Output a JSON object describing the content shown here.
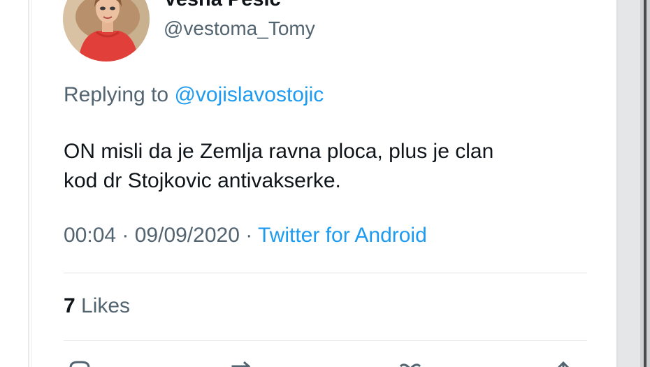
{
  "tweet": {
    "author": {
      "display_name": "Vesna Pesic",
      "handle": "@vestoma_Tomy"
    },
    "reply": {
      "prefix": "Replying to ",
      "mention": "@vojislavostojic"
    },
    "text_line1": "ON misli da je Zemlja ravna ploca, plus je clan",
    "text_line2": "kod dr Stojkovic antivakserke.",
    "timestamp": "00:04 · 09/09/2020 · ",
    "source": "Twitter for Android",
    "likes": {
      "count": "7",
      "label": " Likes"
    }
  },
  "icons": {
    "more": "chevron-down-icon",
    "actions": [
      "reply-icon",
      "retweet-icon",
      "like-icon",
      "share-icon"
    ]
  },
  "colors": {
    "text": "#0f1419",
    "secondary": "#536471",
    "link": "#1d9bf0",
    "divider": "#dfe3e6"
  }
}
